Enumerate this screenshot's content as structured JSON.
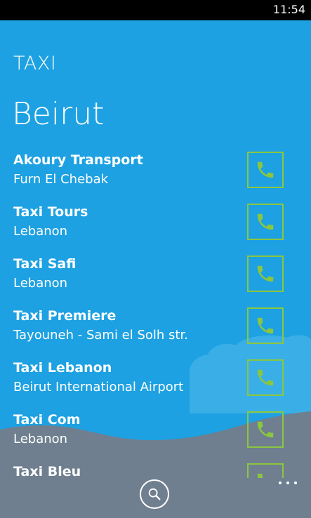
{
  "status": {
    "time": "11:54"
  },
  "app": {
    "title": "TAXI"
  },
  "page": {
    "title": "Beirut"
  },
  "taxis": [
    {
      "name": "Akoury Transport",
      "location": "Furn El Chebak"
    },
    {
      "name": "Taxi Tours",
      "location": "Lebanon"
    },
    {
      "name": "Taxi Safi",
      "location": "Lebanon"
    },
    {
      "name": "Taxi Premiere",
      "location": "Tayouneh - Sami el Solh str."
    },
    {
      "name": "Taxi Lebanon",
      "location": "Beirut International Airport"
    },
    {
      "name": "Taxi Com",
      "location": "Lebanon"
    },
    {
      "name": "Taxi Bleu",
      "location": ""
    }
  ],
  "icons": {
    "call": "phone-icon",
    "search": "search-icon",
    "more": "ellipsis-icon"
  },
  "colors": {
    "background": "#1da1e2",
    "accent": "#8bc63f",
    "appbar": "#6f7f8f",
    "status_bar": "#000000"
  }
}
